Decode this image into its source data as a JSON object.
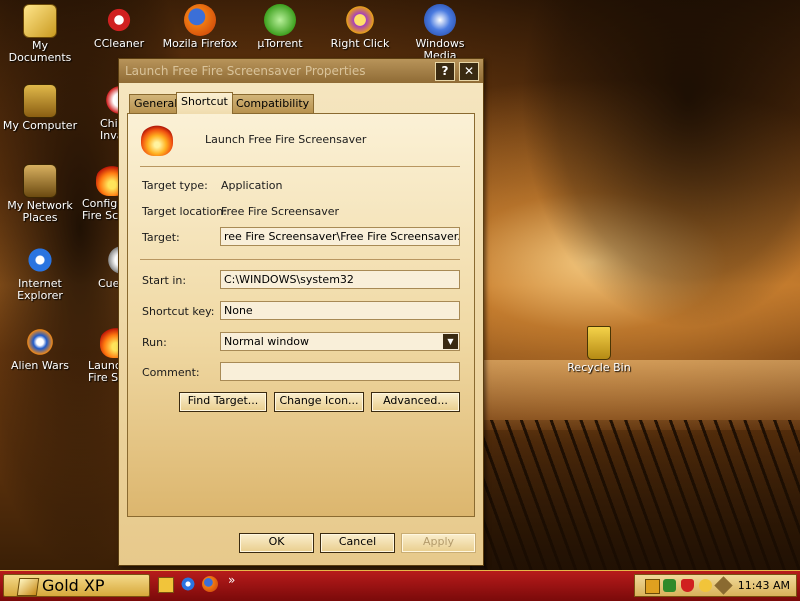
{
  "desktop": {
    "icons": [
      {
        "label": "My Documents"
      },
      {
        "label": "CCleaner"
      },
      {
        "label": "Mozila Firefox"
      },
      {
        "label": "µTorrent"
      },
      {
        "label": "Right Click"
      },
      {
        "label": "Windows Media"
      },
      {
        "label": "My Computer"
      },
      {
        "label": "Chi"
      },
      {
        "label": "Inva"
      },
      {
        "label": "My Network"
      },
      {
        "label": "Places"
      },
      {
        "label": "Configu"
      },
      {
        "label": "Fire Sc"
      },
      {
        "label": "Internet"
      },
      {
        "label": "Explorer"
      },
      {
        "label": "Cue"
      },
      {
        "label": "Alien Wars"
      },
      {
        "label": "Launc"
      },
      {
        "label": "Fire S"
      },
      {
        "label": "Recycle Bin"
      }
    ]
  },
  "dialog": {
    "title": "Launch Free Fire Screensaver Properties",
    "help_button": "?",
    "close_button": "✕",
    "tabs": [
      {
        "label": "General"
      },
      {
        "label": "Shortcut"
      },
      {
        "label": "Compatibility"
      }
    ],
    "shortcut_name": "Launch Free Fire Screensaver",
    "target_type_label": "Target type:",
    "target_type_value": "Application",
    "target_location_label": "Target location:",
    "target_location_value": "Free Fire Screensaver",
    "target_label": "Target:",
    "target_value": "ree Fire Screensaver\\Free Fire Screensaver.exe\"",
    "start_in_label": "Start in:",
    "start_in_value": "C:\\WINDOWS\\system32",
    "shortcut_key_label": "Shortcut key:",
    "shortcut_key_value": "None",
    "run_label": "Run:",
    "run_value": "Normal window",
    "comment_label": "Comment:",
    "comment_value": "",
    "find_target_button": "Find Target...",
    "change_icon_button": "Change Icon...",
    "advanced_button": "Advanced...",
    "ok_button": "OK",
    "cancel_button": "Cancel",
    "apply_button": "Apply"
  },
  "taskbar": {
    "start_label": "Gold XP",
    "chevron": "»",
    "clock": "11:43 AM"
  },
  "colors": {
    "taskbar": "#9e1414",
    "dialog_bg": "#f3e2b9",
    "accent": "#d7a83b"
  }
}
